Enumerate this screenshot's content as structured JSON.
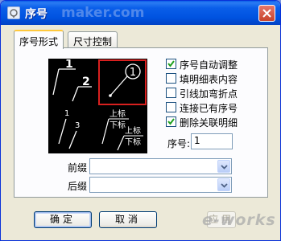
{
  "window": {
    "title": "序号",
    "watermark": "maker.com",
    "icon": "app-icon",
    "close_icon": "close-icon"
  },
  "tabs": [
    {
      "label": "序号形式",
      "active": true
    },
    {
      "label": "尺寸控制",
      "active": false
    }
  ],
  "style_grid": {
    "selected_index": 1,
    "cells": [
      {
        "labels": [
          "1",
          "2"
        ]
      },
      {
        "labels": [
          "1"
        ]
      },
      {
        "labels": [
          "1",
          "3"
        ]
      },
      {
        "labels": [
          "上标",
          "下标",
          "上标",
          "下标"
        ]
      }
    ]
  },
  "options": [
    {
      "label": "序号自动调整",
      "checked": true
    },
    {
      "label": "填明细表内容",
      "checked": false
    },
    {
      "label": "引线加弯折点",
      "checked": false
    },
    {
      "label": "连接已有序号",
      "checked": false
    },
    {
      "label": "删除关联明细",
      "checked": true
    }
  ],
  "number": {
    "label": "序号:",
    "value": "1"
  },
  "prefix": {
    "label": "前缀",
    "value": ""
  },
  "suffix": {
    "label": "后缀",
    "value": ""
  },
  "buttons": {
    "ok": "确定",
    "cancel": "取消",
    "apply": "应用"
  },
  "logo_text": "e-works",
  "colors": {
    "selection_border": "#d8201f",
    "title_bar": "#0a5ee9"
  }
}
